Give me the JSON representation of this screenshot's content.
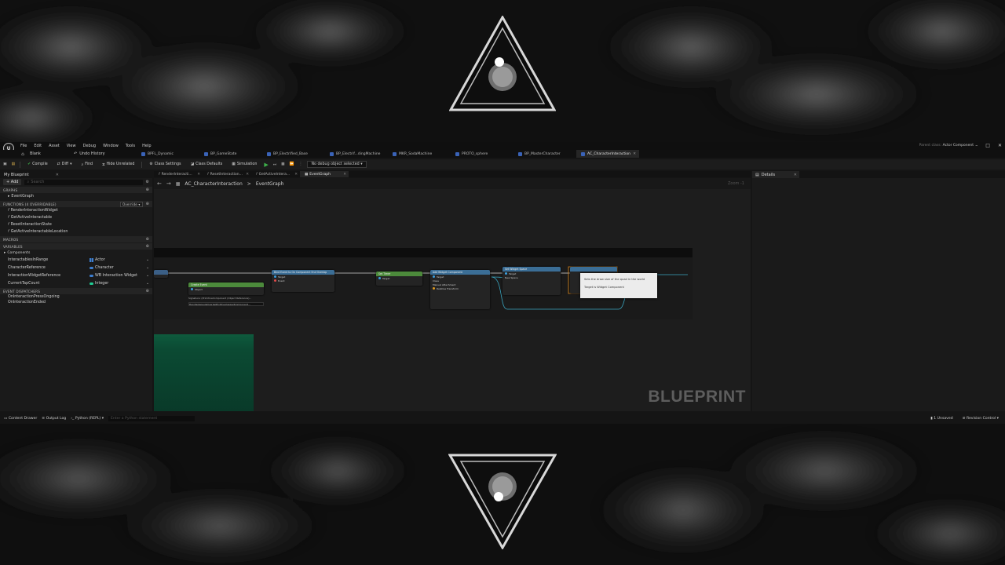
{
  "menu": [
    "File",
    "Edit",
    "Asset",
    "View",
    "Debug",
    "Window",
    "Tools",
    "Help"
  ],
  "project_name": "Blank",
  "undo_label": "Undo History",
  "asset_tabs": [
    {
      "label": "BPFL_Dynamic",
      "active": false
    },
    {
      "label": "BP_GameState",
      "active": false
    },
    {
      "label": "BP_Electrified_Base",
      "active": false
    },
    {
      "label": "BP_Electrif...dingMachine",
      "active": false
    },
    {
      "label": "MKR_SodaMachine",
      "active": false
    },
    {
      "label": "PROTO_sphere",
      "active": false
    },
    {
      "label": "BP_MasterCharacter",
      "active": false
    },
    {
      "label": "AC_CharacterInteraction",
      "active": true
    }
  ],
  "parent_class": {
    "label": "Parent class:",
    "value": "Actor Component"
  },
  "toolbar": {
    "compile": "Compile",
    "diff": "Diff",
    "find": "Find",
    "hide_unrelated": "Hide Unrelated",
    "class_settings": "Class Settings",
    "class_defaults": "Class Defaults",
    "simulation": "Simulation",
    "debug_object": "No debug object selected"
  },
  "my_blueprint": {
    "tab": "My Blueprint",
    "add": "+ Add",
    "search_placeholder": "Search",
    "graphs_header": "GRAPHS",
    "graphs": [
      "EventGraph"
    ],
    "functions_header": "FUNCTIONS (4 OVERRIDABLE)",
    "override_label": "Override",
    "functions": [
      "RenderInteractionWidget",
      "GetActiveInteractable",
      "ResetInteractionState",
      "GetActiveInteractableLocation"
    ],
    "macros_header": "MACROS",
    "variables_header": "VARIABLES",
    "components_label": "Components",
    "variables": [
      {
        "name": "InteractablesInRange",
        "type": "Actor",
        "color": "#3d7fd1"
      },
      {
        "name": "CharacterReference",
        "type": "Character",
        "color": "#3d7fd1"
      },
      {
        "name": "InteractionWidgetReference",
        "type": "WB Interaction Widget",
        "color": "#3d7fd1"
      },
      {
        "name": "CurrentTapCount",
        "type": "Integer",
        "color": "#1fcf95"
      }
    ],
    "dispatchers_header": "EVENT DISPATCHERS",
    "dispatchers": [
      "OnInteractionPressOngoing",
      "OnInteractionEnded"
    ]
  },
  "graph_tabs": [
    {
      "label": "RenderInteracti...",
      "active": false
    },
    {
      "label": "ResetInteraction...",
      "active": false
    },
    {
      "label": "GetActiveIntera...",
      "active": false
    },
    {
      "label": "EventGraph",
      "active": true
    }
  ],
  "breadcrumb": {
    "root": "AC_CharacterInteraction",
    "sep": ">",
    "leaf": "EventGraph"
  },
  "zoom": "Zoom -1",
  "nodes": {
    "bind_title": "Bind Event to On Component End Overlap",
    "create_event": "Create Event",
    "signature": "Signature: (PrimitiveComponent (Object Reference)...",
    "handle_fn": "HandleCapsuleOverlapEndOverlappedComponent...",
    "set_timer": "Set Timer",
    "add_widget": "Add Widget Component",
    "set_widget_space": "Set Widget Space",
    "pin_target": "Target",
    "pin_object": "Object",
    "pin_event": "Event",
    "pin_return": "Return Value",
    "pin_class": "Class",
    "pin_new_space": "New Space",
    "pin_manual": "Manual Attachment",
    "pin_relative": "Relative Transform"
  },
  "tooltip": {
    "line1": "Sets the draw size of the quad in the world",
    "line2": "Target is Widget Component"
  },
  "watermark": "BLUEPRINT",
  "details": {
    "tab": "Details"
  },
  "statusbar": {
    "content_drawer": "Content Drawer",
    "output_log": "Output Log",
    "python": "Python (REPL)",
    "cmd_placeholder": "Enter a Python statement",
    "unsaved": "1 Unsaved",
    "revision": "Revision Control"
  }
}
